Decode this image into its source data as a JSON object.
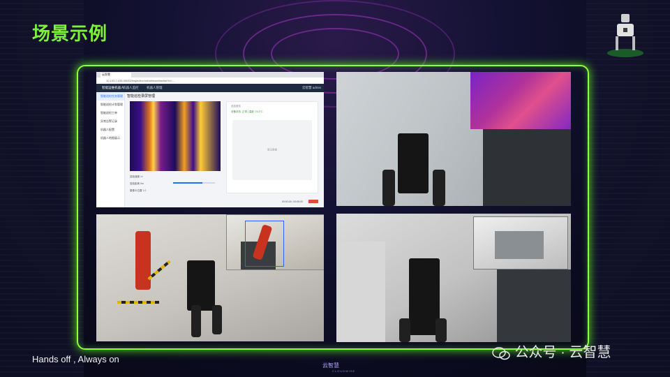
{
  "slide": {
    "title": "场景示例",
    "tagline": "Hands off , Always on",
    "watermark": "公众号 · 云智慧",
    "footer_logo_text": "云智慧",
    "footer_logo_sub": "CLOUDWISE",
    "frame_color": "#8dff3c",
    "title_color": "#7ef23a"
  },
  "screenshot_app": {
    "browser_tab": "云智慧",
    "url": "10.103.2.155:30033/inspection/robot/machine/list?id=...",
    "app_brand": "智能运维机器人",
    "menu_items": [
      "机器人监控",
      "机器人管理"
    ],
    "header_right": "云智慧 admin",
    "page_title": "智能巡检录屏管理",
    "sidebar": [
      "智能巡检任务管理",
      "智能巡检计划管理",
      "智能巡检工单",
      "异常告警记录",
      "机器人配置",
      "机器人地图展示"
    ],
    "right_panel_label": "巡检报告",
    "right_panel_status": "设备状态: 正常 | 温度: 24.3°C",
    "blank_text": "暂无数据",
    "controls": [
      "巡检速度",
      "巡检距离",
      "摄像头位置"
    ],
    "control_values": [
      "1×",
      "0m",
      "1.0"
    ],
    "slider_level": 0.7,
    "time": "00:00:18 / 00:05:00"
  },
  "icons": [
    "robot-logo-icon",
    "wechat-icon",
    "cloudwise-logo-icon",
    "browser-tab-icon"
  ]
}
